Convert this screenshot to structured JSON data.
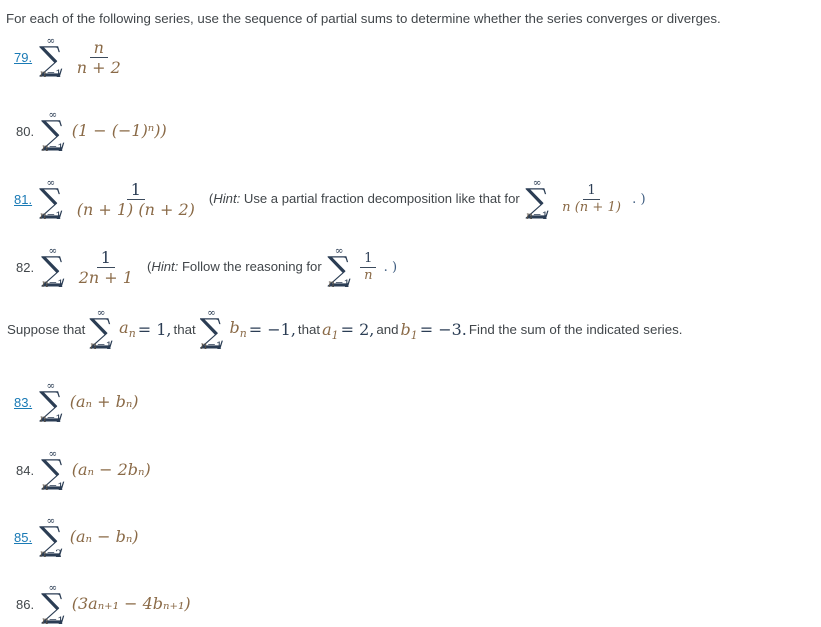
{
  "document": {
    "headline": "For each of the following series, use the sequence of partial sums to determine whether the series converges or diverges.",
    "suppose": {
      "lead": "Suppose that",
      "eq1_value": "= 1,",
      "that2": "that",
      "eq2_value": "= −1,",
      "that3": "that",
      "a1": "a",
      "a1_sub": "1",
      "a1_value": "= 2,",
      "and": "and",
      "b1": "b",
      "b1_sub": "1",
      "b1_value": "= −3.",
      "tail": "Find the sum of the indicated series."
    },
    "link_color": "#1a7ab5",
    "text_color": "#41464a",
    "math_color": "#2b3d54"
  },
  "exercises": [
    {
      "number": "79.",
      "is_link": true,
      "sum_upper": "∞",
      "sum_lower_var": "n",
      "sum_lower_eq": "=1",
      "body_kind": "fraction",
      "numerator": "n",
      "denominator": "n + 2",
      "hint": null
    },
    {
      "number": "80.",
      "is_link": false,
      "sum_upper": "∞",
      "sum_lower_var": "n",
      "sum_lower_eq": "=1",
      "body_kind": "inline",
      "expression": "(1 − (−1)ⁿ))",
      "hint": null
    },
    {
      "number": "81.",
      "is_link": true,
      "sum_upper": "∞",
      "sum_lower_var": "n",
      "sum_lower_eq": "=1",
      "body_kind": "fraction",
      "numerator": "1",
      "denominator": "(n + 1) (n + 2)",
      "hint": {
        "open": "(",
        "label": "Hint:",
        "text": "Use a partial fraction decomposition like that for",
        "inline_sum_upper": "∞",
        "inline_sum_lower_var": "n",
        "inline_sum_lower_eq": "=1",
        "inline_numerator": "1",
        "inline_denominator": "n (n + 1)",
        "close": ". )"
      }
    },
    {
      "number": "82.",
      "is_link": false,
      "sum_upper": "∞",
      "sum_lower_var": "n",
      "sum_lower_eq": "=1",
      "body_kind": "fraction",
      "numerator": "1",
      "denominator": "2n + 1",
      "hint": {
        "open": "(",
        "label": "Hint:",
        "text": "Follow the reasoning for",
        "inline_sum_upper": "∞",
        "inline_sum_lower_var": "n",
        "inline_sum_lower_eq": "=1",
        "inline_numerator": "1",
        "inline_denominator": "n",
        "close": ". )"
      }
    },
    {
      "number": "83.",
      "is_link": true,
      "sum_upper": "∞",
      "sum_lower_var": "n",
      "sum_lower_eq": "=1",
      "body_kind": "inline",
      "expression": "(aₙ + bₙ)",
      "hint": null
    },
    {
      "number": "84.",
      "is_link": false,
      "sum_upper": "∞",
      "sum_lower_var": "n",
      "sum_lower_eq": "=1",
      "body_kind": "inline",
      "expression": "(aₙ − 2bₙ)",
      "hint": null
    },
    {
      "number": "85.",
      "is_link": true,
      "sum_upper": "∞",
      "sum_lower_var": "n",
      "sum_lower_eq": "=2",
      "body_kind": "inline",
      "expression": "(aₙ − bₙ)",
      "hint": null
    },
    {
      "number": "86.",
      "is_link": false,
      "sum_upper": "∞",
      "sum_lower_var": "n",
      "sum_lower_eq": "=1",
      "body_kind": "inline",
      "expression": "(3aₙ₊₁ − 4bₙ₊₁)",
      "hint": null
    }
  ]
}
